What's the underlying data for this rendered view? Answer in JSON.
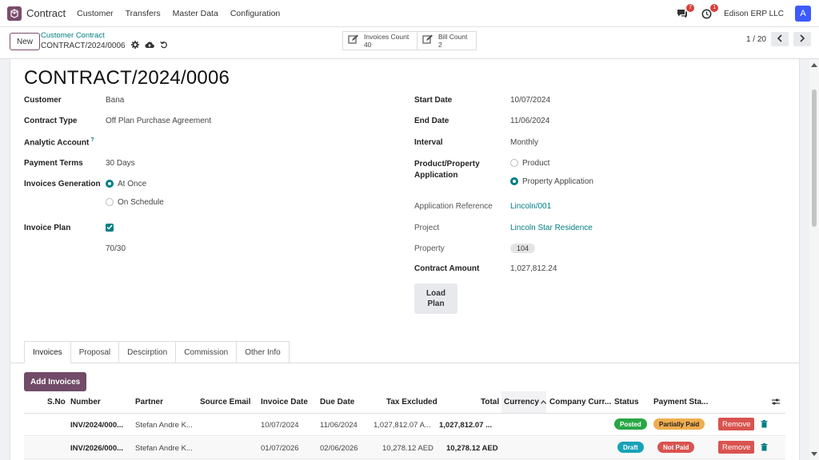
{
  "navbar": {
    "app_title": "Contract",
    "menu": [
      "Customer",
      "Transfers",
      "Master Data",
      "Configuration"
    ],
    "messages_count": "7",
    "activities_count": "1",
    "company": "Edison ERP LLC",
    "avatar_letter": "A"
  },
  "control": {
    "new_label": "New",
    "breadcrumb_parent": "Customer Contract",
    "breadcrumb_current": "CONTRACT/2024/0006",
    "smart_buttons": [
      {
        "label": "Invoices Count",
        "value": "40"
      },
      {
        "label": "Bill Count",
        "value": "2"
      }
    ],
    "pager": "1 / 20"
  },
  "form": {
    "title": "CONTRACT/2024/0006",
    "left": {
      "customer_label": "Customer",
      "customer_value": "Bana",
      "contract_type_label": "Contract Type",
      "contract_type_value": "Off Plan Purchase Agreement",
      "analytic_label": "Analytic Account",
      "analytic_help": "?",
      "payment_terms_label": "Payment Terms",
      "payment_terms_value": "30 Days",
      "invoices_gen_label": "Invoices Generation",
      "option_at_once": "At Once",
      "option_on_schedule": "On Schedule",
      "invoice_plan_label": "Invoice Plan",
      "invoice_plan_value": "70/30"
    },
    "right": {
      "start_label": "Start Date",
      "start_value": "10/07/2024",
      "end_label": "End Date",
      "end_value": "11/06/2024",
      "interval_label": "Interval",
      "interval_value": "Monthly",
      "pp_label_1": "Product/Property",
      "pp_label_2": "Application",
      "option_product": "Product",
      "option_property": "Property Application",
      "app_ref_label": "Application Reference",
      "app_ref_value": "Lincoln/001",
      "project_label": "Project",
      "project_value": "Lincoln Star Residence",
      "property_label": "Property",
      "property_value": "104",
      "amount_label": "Contract Amount",
      "amount_value": "1,027,812.24",
      "load_plan_1": "Load",
      "load_plan_2": "Plan"
    }
  },
  "tabs": [
    "Invoices",
    "Proposal",
    "Descirption",
    "Commission",
    "Other Info"
  ],
  "invoices": {
    "add_label": "Add Invoices",
    "columns": [
      "S.No",
      "Number",
      "Partner",
      "Source Email",
      "Invoice Date",
      "Due Date",
      "Tax Excluded",
      "Total",
      "Currency",
      "Company Curr...",
      "Status",
      "Payment Sta..."
    ],
    "rows": [
      {
        "number": "INV/2024/000...",
        "partner": "Stefan Andre K...",
        "invoice_date": "10/07/2024",
        "due_date": "11/06/2024",
        "tax_excluded": "1,027,812.07 A...",
        "total": "1,027,812.07 ...",
        "status": "Posted",
        "payment_status": "Partially Paid",
        "remove": "Remove"
      },
      {
        "number": "INV/2026/000...",
        "partner": "Stefan Andre K...",
        "invoice_date": "01/07/2026",
        "due_date": "02/06/2026",
        "tax_excluded": "10,278.12 AED",
        "total": "10,278.12 AED",
        "status": "Draft",
        "payment_status": "Not Paid",
        "remove": "Remove"
      }
    ]
  },
  "colors": {
    "brand": "#714b67",
    "accent": "#017e84",
    "posted": "#28a745",
    "draft": "#17a2b8",
    "partially_paid": "#f0ad4e",
    "not_paid": "#d9534f"
  }
}
